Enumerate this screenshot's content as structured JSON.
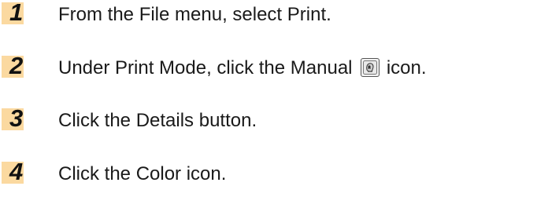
{
  "steps": [
    {
      "number": "1",
      "text": "From the File menu, select Print."
    },
    {
      "number": "2",
      "text_before": "Under Print Mode, click the Manual",
      "icon": "manual-mode-icon",
      "text_after": "icon."
    },
    {
      "number": "3",
      "text": "Click the Details button."
    },
    {
      "number": "4",
      "text": "Click the Color icon."
    }
  ],
  "colors": {
    "number_highlight": "#fbd9a0",
    "text": "#1a1a1a"
  }
}
